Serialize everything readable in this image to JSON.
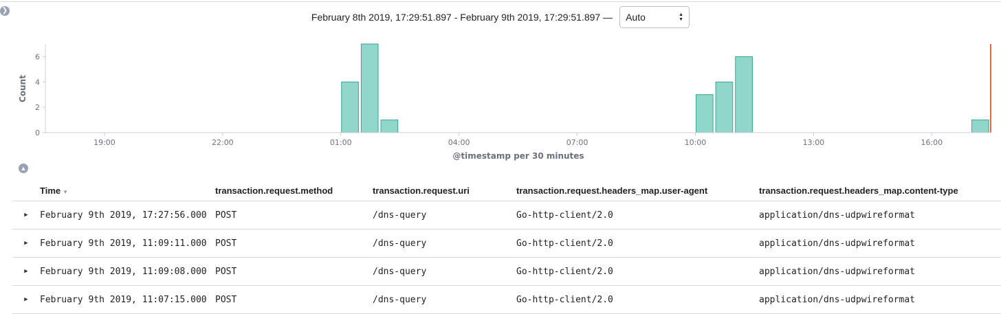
{
  "header": {
    "time_range": "February 8th 2019, 17:29:51.897 - February 9th 2019, 17:29:51.897 —",
    "interval_value": "Auto"
  },
  "colors": {
    "bar_fill": "#8fd6cb",
    "bar_stroke": "#3aa393",
    "now_marker": "#e7664c",
    "grid": "#d3dae6"
  },
  "chart_data": {
    "type": "bar",
    "xlabel": "@timestamp per 30 minutes",
    "ylabel": "Count",
    "ylim": [
      0,
      7
    ],
    "yticks": [
      0,
      2,
      4,
      6
    ],
    "xticks": [
      "19:00",
      "22:00",
      "01:00",
      "04:00",
      "07:00",
      "10:00",
      "13:00",
      "16:00"
    ],
    "x": [
      "01:00",
      "01:30",
      "02:00",
      "10:00",
      "10:30",
      "11:00",
      "17:00"
    ],
    "values": [
      4,
      7,
      1,
      3,
      4,
      6,
      1
    ]
  },
  "table": {
    "columns": [
      "Time",
      "transaction.request.method",
      "transaction.request.uri",
      "transaction.request.headers_map.user-agent",
      "transaction.request.headers_map.content-type"
    ],
    "rows": [
      [
        "February 9th 2019, 17:27:56.000",
        "POST",
        "/dns-query",
        "Go-http-client/2.0",
        "application/dns-udpwireformat"
      ],
      [
        "February 9th 2019, 11:09:11.000",
        "POST",
        "/dns-query",
        "Go-http-client/2.0",
        "application/dns-udpwireformat"
      ],
      [
        "February 9th 2019, 11:09:08.000",
        "POST",
        "/dns-query",
        "Go-http-client/2.0",
        "application/dns-udpwireformat"
      ],
      [
        "February 9th 2019, 11:07:15.000",
        "POST",
        "/dns-query",
        "Go-http-client/2.0",
        "application/dns-udpwireformat"
      ]
    ]
  }
}
